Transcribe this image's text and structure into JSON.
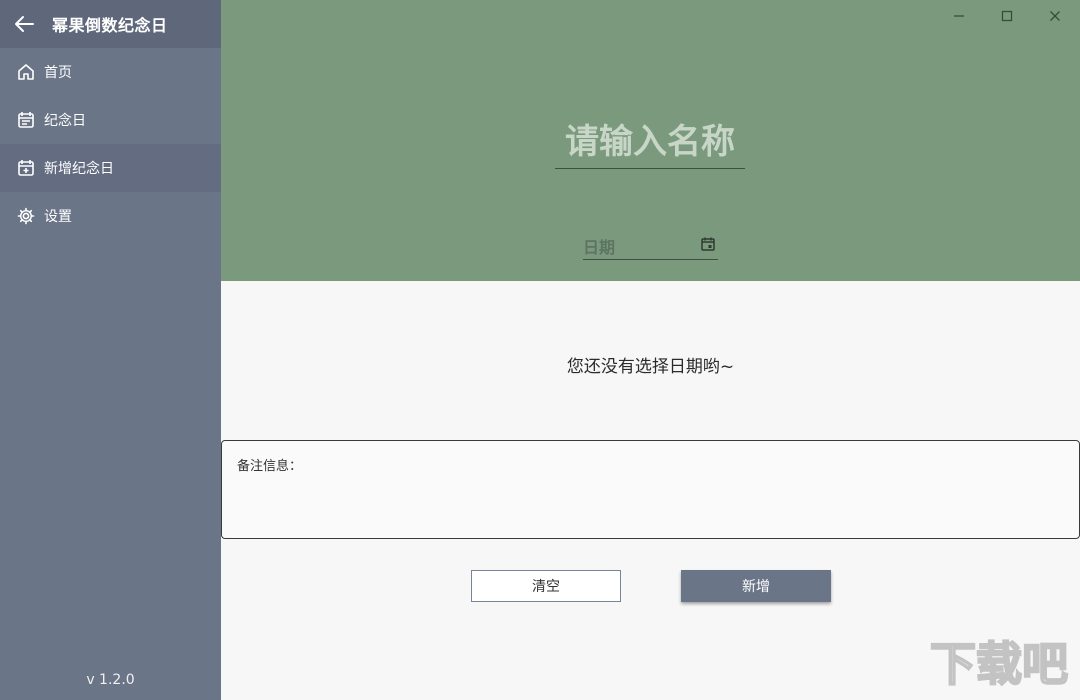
{
  "app": {
    "title": "幂果倒数纪念日",
    "version": "v 1.2.0"
  },
  "sidebar": {
    "items": [
      {
        "label": "首页",
        "icon": "home-icon"
      },
      {
        "label": "纪念日",
        "icon": "calendar-icon"
      },
      {
        "label": "新增纪念日",
        "icon": "calendar-add-icon",
        "active": true
      },
      {
        "label": "设置",
        "icon": "gear-icon"
      }
    ]
  },
  "window_controls": [
    "minimize",
    "maximize",
    "close"
  ],
  "form": {
    "name_placeholder": "请输入名称",
    "date_placeholder": "日期",
    "message": "您还没有选择日期哟~",
    "notes_label": "备注信息：",
    "clear_label": "清空",
    "add_label": "新增"
  },
  "watermark": {
    "text": "下载吧"
  },
  "colors": {
    "sidebar": "#6b7588",
    "hero": "#7b9a7d",
    "accent_button": "#6b7588"
  }
}
